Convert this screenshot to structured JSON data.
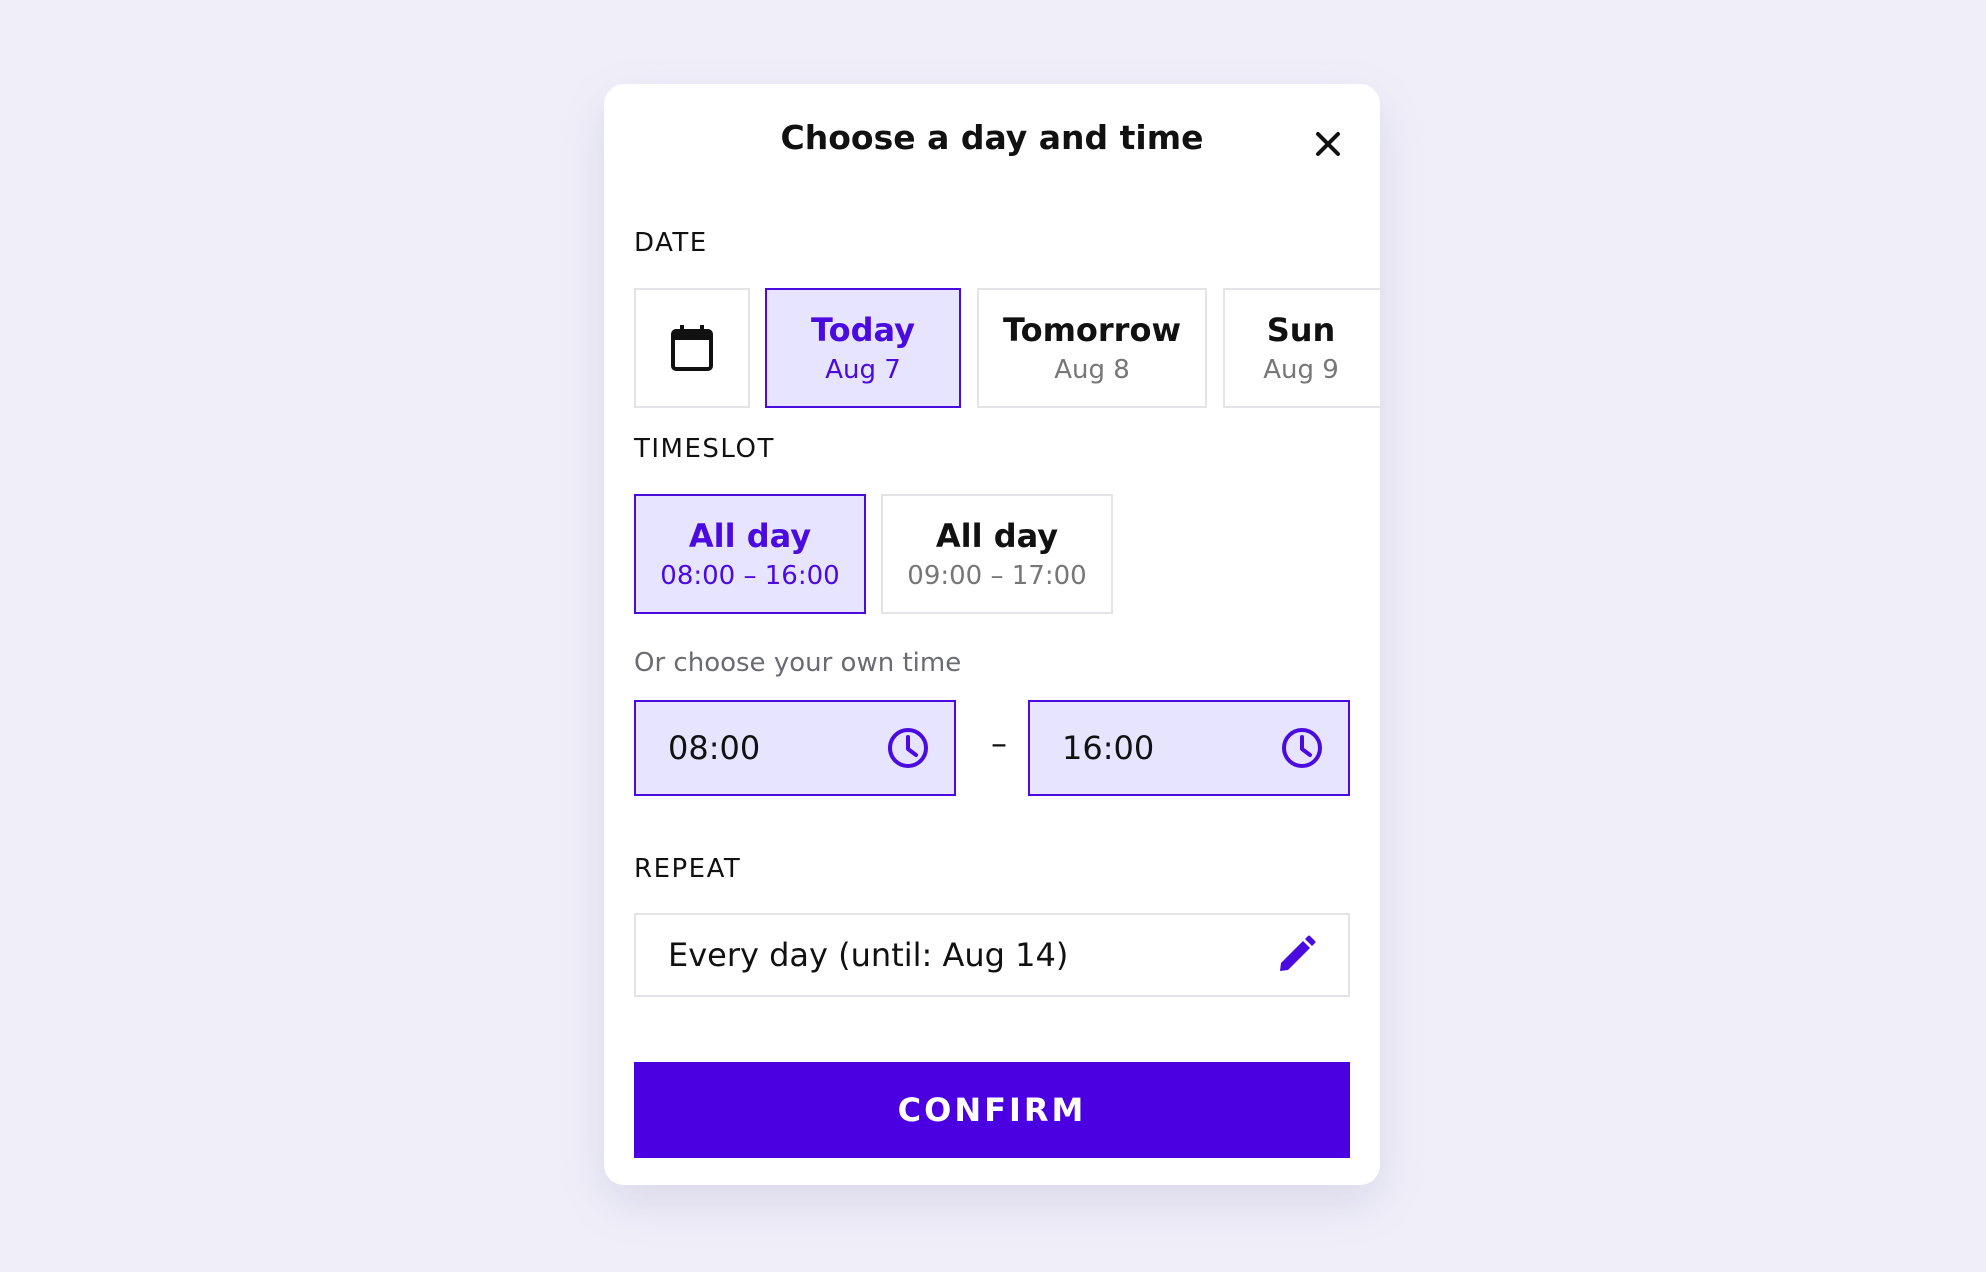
{
  "dialog": {
    "title": "Choose a day and time",
    "close_icon": "close-icon"
  },
  "date": {
    "label": "DATE",
    "calendar_icon": "calendar-icon",
    "options": [
      {
        "day": "Today",
        "date": "Aug 7",
        "selected": true
      },
      {
        "day": "Tomorrow",
        "date": "Aug 8",
        "selected": false
      },
      {
        "day": "Sun",
        "date": "Aug 9",
        "selected": false
      }
    ]
  },
  "timeslot": {
    "label": "TIMESLOT",
    "options": [
      {
        "name": "All day",
        "range": "08:00 – 16:00",
        "selected": true
      },
      {
        "name": "All day",
        "range": "09:00 – 17:00",
        "selected": false
      }
    ]
  },
  "custom_time": {
    "helper": "Or choose your own time",
    "start": "08:00",
    "separator": "–",
    "end": "16:00",
    "clock_icon": "clock-icon"
  },
  "repeat": {
    "label": "REPEAT",
    "value": "Every day (until: Aug 14)",
    "edit_icon": "pencil-icon"
  },
  "confirm_label": "CONFIRM",
  "colors": {
    "accent": "#4a00e0",
    "selected_bg": "#e6e4ff",
    "page_bg": "#f0eff9"
  }
}
